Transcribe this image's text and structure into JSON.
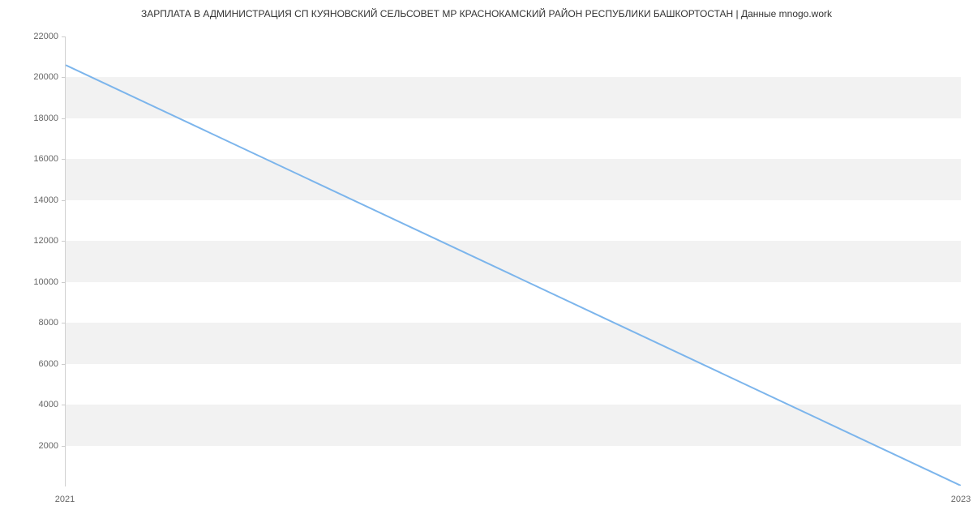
{
  "chart_data": {
    "type": "line",
    "title": "ЗАРПЛАТА В АДМИНИСТРАЦИЯ СП КУЯНОВСКИЙ СЕЛЬСОВЕТ МР КРАСНОКАМСКИЙ РАЙОН РЕСПУБЛИКИ БАШКОРТОСТАН | Данные mnogo.work",
    "x": [
      2021,
      2023
    ],
    "values": [
      20600,
      0
    ],
    "xlabel": "",
    "ylabel": "",
    "xlim": [
      2021,
      2023
    ],
    "ylim": [
      0,
      22000
    ],
    "y_ticks": [
      2000,
      4000,
      6000,
      8000,
      10000,
      12000,
      14000,
      16000,
      18000,
      20000,
      22000
    ],
    "x_ticks": [
      2021,
      2023
    ],
    "line_color": "#7cb5ec"
  }
}
